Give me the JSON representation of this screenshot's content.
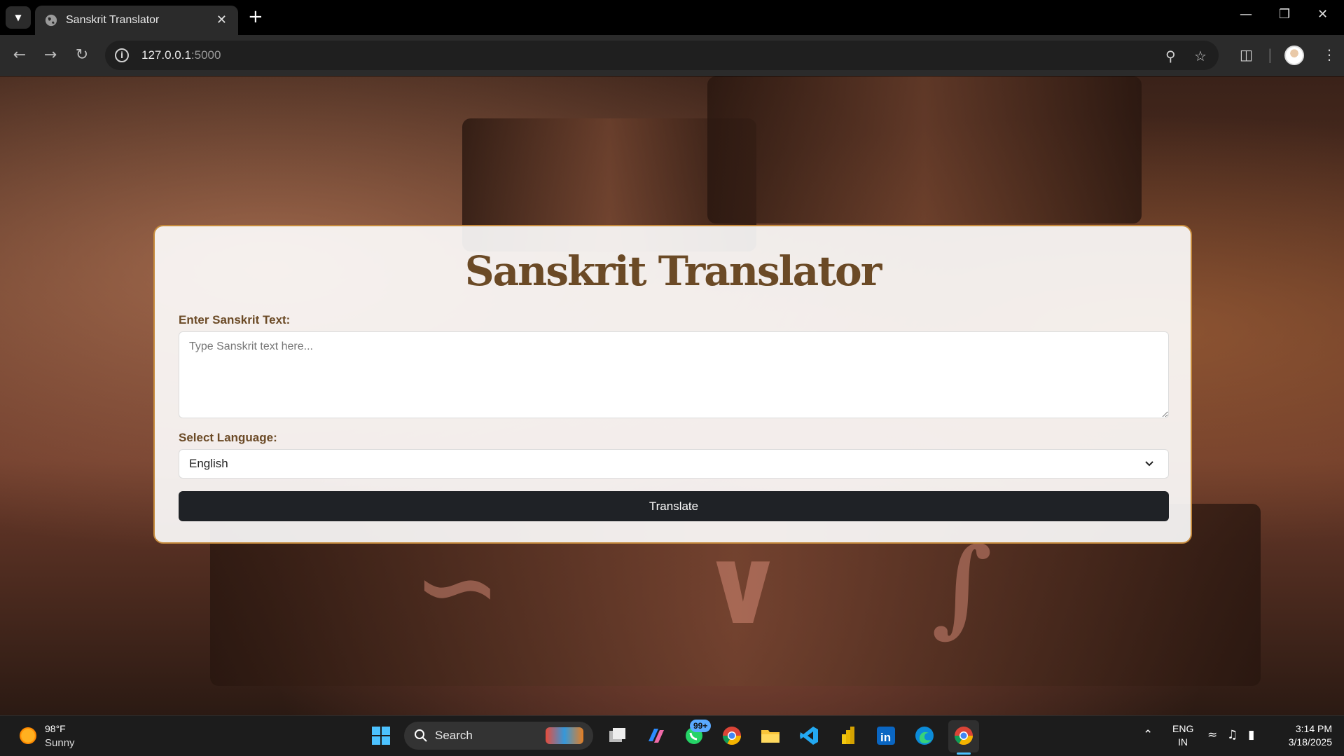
{
  "browser": {
    "tab_title": "Sanskrit Translator",
    "url_host": "127.0.0.1",
    "url_port": ":5000"
  },
  "app": {
    "title": "Sanskrit Translator",
    "input_label": "Enter Sanskrit Text:",
    "input_placeholder": "Type Sanskrit text here...",
    "input_value": "",
    "language_label": "Select Language:",
    "language_selected": "English",
    "translate_button": "Translate"
  },
  "taskbar": {
    "temperature": "98°F",
    "weather": "Sunny",
    "search_label": "Search",
    "whatsapp_badge": "99+",
    "lang_line1": "ENG",
    "lang_line2": "IN",
    "time": "3:14 PM",
    "date": "3/18/2025"
  },
  "colors": {
    "title": "#6b4a26",
    "card_border": "#c58a3c",
    "button_bg": "#1f2226"
  }
}
